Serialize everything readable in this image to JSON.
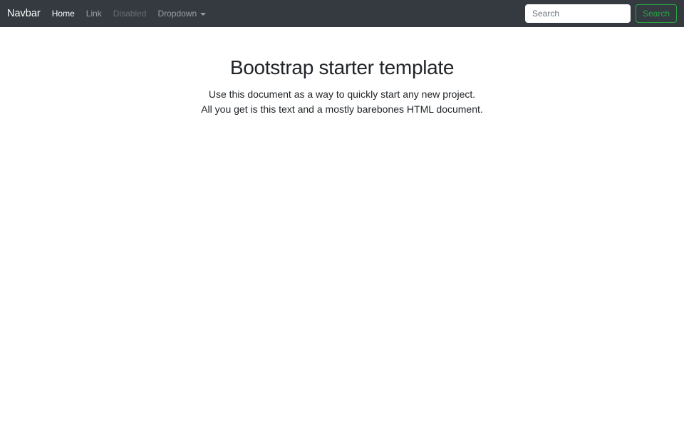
{
  "navbar": {
    "brand": "Navbar",
    "items": [
      {
        "label": "Home",
        "state": "active"
      },
      {
        "label": "Link",
        "state": "default"
      },
      {
        "label": "Disabled",
        "state": "disabled"
      },
      {
        "label": "Dropdown",
        "state": "dropdown",
        "icon": "caret-down-icon"
      }
    ],
    "search": {
      "placeholder": "Search",
      "button_label": "Search"
    }
  },
  "main": {
    "title": "Bootstrap starter template",
    "lead_line1": "Use this document as a way to quickly start any new project.",
    "lead_line2": "All you get is this text and a mostly barebones HTML document."
  },
  "colors": {
    "navbar_bg": "#343a40",
    "brand_text": "#ffffff",
    "nav_active": "#ffffff",
    "nav_muted": "rgba(255,255,255,0.5)",
    "nav_disabled": "rgba(255,255,255,0.25)",
    "success": "#28a745",
    "body_text": "#212529",
    "placeholder": "#6c757d",
    "page_bg": "#ffffff"
  }
}
